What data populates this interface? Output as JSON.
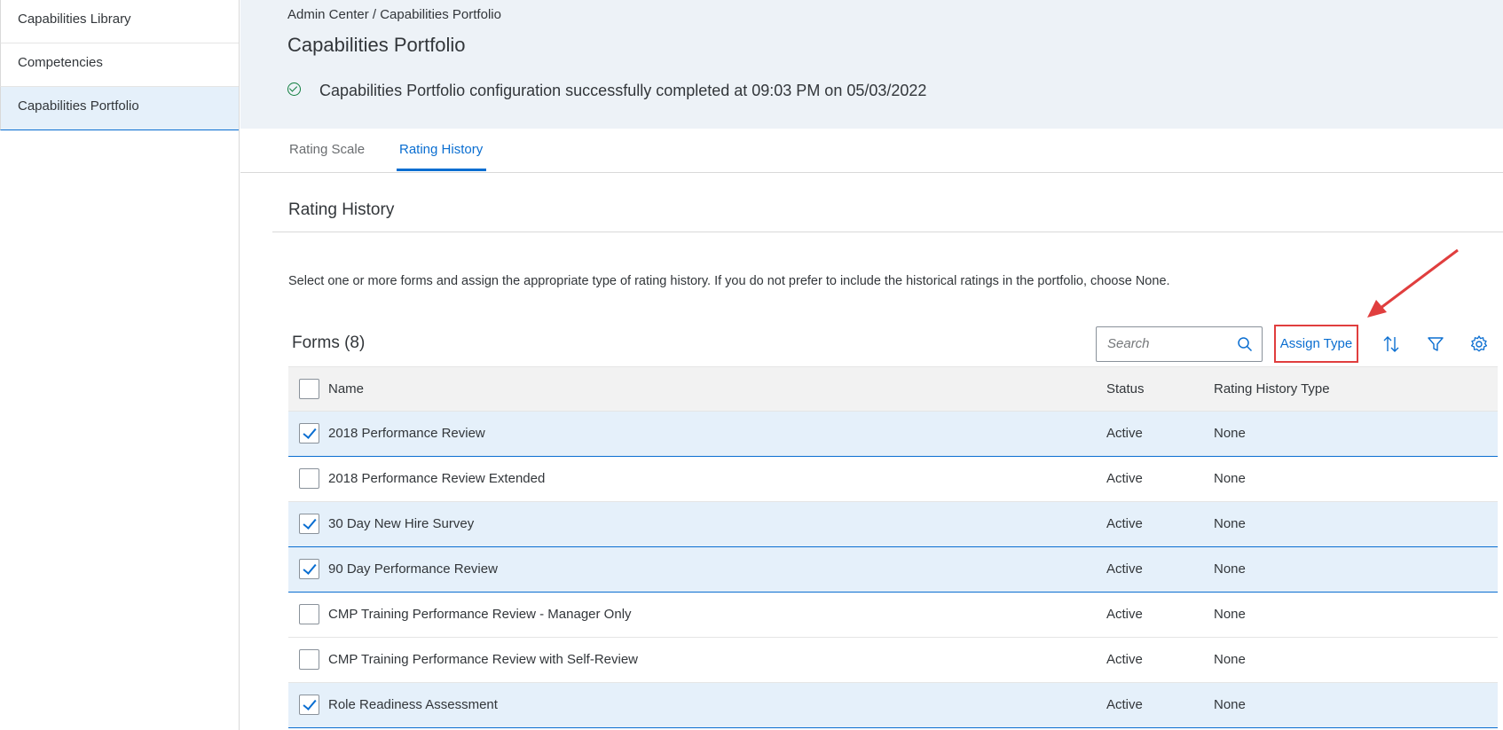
{
  "sidebar": {
    "items": [
      {
        "label": "Capabilities Library"
      },
      {
        "label": "Competencies"
      },
      {
        "label": "Capabilities Portfolio"
      }
    ]
  },
  "header": {
    "breadcrumb": "Admin Center / Capabilities Portfolio",
    "title": "Capabilities Portfolio",
    "status_message": "Capabilities Portfolio configuration successfully completed at 09:03 PM on 05/03/2022"
  },
  "tabs": [
    {
      "label": "Rating Scale",
      "active": false
    },
    {
      "label": "Rating History",
      "active": true
    }
  ],
  "section": {
    "title": "Rating History",
    "instructions": "Select one or more forms and assign the appropriate type of rating history. If you do not prefer to include the historical ratings in the portfolio, choose None."
  },
  "forms": {
    "title": "Forms (8)",
    "search_placeholder": "Search",
    "assign_type_label": "Assign Type",
    "columns": {
      "name": "Name",
      "status": "Status",
      "type": "Rating History Type"
    },
    "rows": [
      {
        "name": "2018 Performance Review",
        "status": "Active",
        "type": "None",
        "checked": true
      },
      {
        "name": "2018 Performance Review Extended",
        "status": "Active",
        "type": "None",
        "checked": false
      },
      {
        "name": "30 Day New Hire Survey",
        "status": "Active",
        "type": "None",
        "checked": true
      },
      {
        "name": "90 Day Performance Review",
        "status": "Active",
        "type": "None",
        "checked": true
      },
      {
        "name": "CMP Training Performance Review - Manager Only",
        "status": "Active",
        "type": "None",
        "checked": false
      },
      {
        "name": "CMP Training Performance Review with Self-Review",
        "status": "Active",
        "type": "None",
        "checked": false
      },
      {
        "name": "Role Readiness Assessment",
        "status": "Active",
        "type": "None",
        "checked": true
      }
    ]
  },
  "colors": {
    "accent": "#0a6ed1",
    "success": "#107e3e",
    "highlight": "#e03e3e"
  },
  "icons": [
    "check-circle-icon",
    "search-icon",
    "sort-icon",
    "filter-icon",
    "settings-gear-icon",
    "checkmark-icon",
    "annotation-arrow"
  ]
}
